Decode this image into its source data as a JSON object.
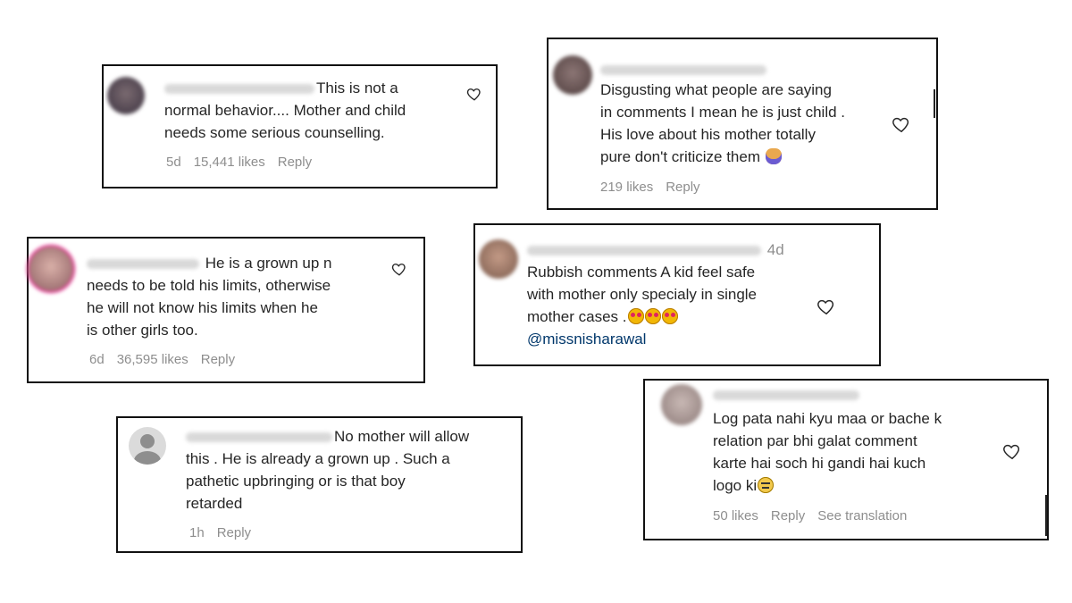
{
  "comments": [
    {
      "id": "c1",
      "avatar_color": "#5a4a52",
      "text": "This is not a normal behavior.... Mother and child needs some serious counselling.",
      "lines": [
        "This is not a",
        "normal behavior.... Mother and child",
        "needs some serious counselling."
      ],
      "age": "5d",
      "likes": "15,441 likes",
      "reply": "Reply"
    },
    {
      "id": "c2",
      "avatar_color": "#6e5a58",
      "lines": [
        "Disgusting what people are saying",
        "in comments I mean he is just child .",
        "His love about his mother totally",
        "pure don't criticize them"
      ],
      "emoji": "person-facepalming",
      "likes": "219 likes",
      "reply": "Reply"
    },
    {
      "id": "c3",
      "avatar_color": "#b87a72",
      "lines": [
        "He is a grown up n",
        "needs to be told his limits, otherwise",
        "he will not know his limits when he",
        "is other girls too."
      ],
      "age": "6d",
      "likes": "36,595 likes",
      "reply": "Reply"
    },
    {
      "id": "c4",
      "avatar_color": "#a07a66",
      "age_inline": "4d",
      "lines": [
        "Rubbish comments A kid feel safe",
        "with mother only specialy in single",
        "mother cases ."
      ],
      "emoji": "smiling-face-with-heart-eyes",
      "mention": "@missnisharawal"
    },
    {
      "id": "c5",
      "avatar_color": "#8e8e8e",
      "lines": [
        "No mother will allow",
        "this . He is already a grown up . Such a",
        "pathetic upbringing or is that boy",
        "retarded"
      ],
      "age": "1h",
      "reply": "Reply"
    },
    {
      "id": "c6",
      "avatar_color": "#a69592",
      "lines": [
        "Log pata nahi kyu maa or bache k",
        "relation par bhi galat comment",
        "karte hai soch hi gandi hai kuch",
        "logo ki"
      ],
      "emoji": "expressionless-face",
      "likes": "50 likes",
      "reply": "Reply",
      "translate": "See translation"
    }
  ],
  "colors": {
    "text": "#262626",
    "meta": "#8e8e8e",
    "mention": "#00376b",
    "border": "#111111"
  }
}
